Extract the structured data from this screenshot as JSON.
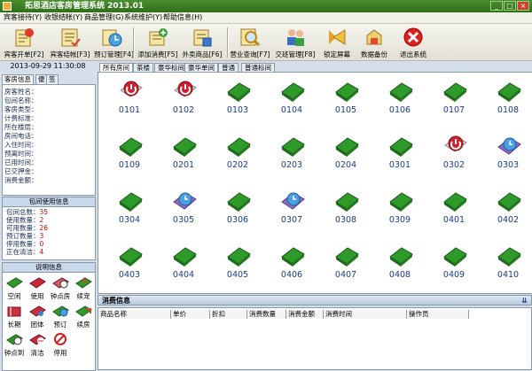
{
  "app": {
    "title": "拓思酒店客房管理系统   2013.01",
    "controls": [
      "_",
      "□",
      "×"
    ]
  },
  "menu": [
    "宾客接待(Y)",
    "收银结帐(Y)",
    "商品管理(G)",
    "系统维护(Y)",
    "帮助信息(H)"
  ],
  "toolbar": [
    {
      "label": "宾客开单[F2]",
      "icon": "open-bill-icon"
    },
    {
      "label": "宾客结帐[F3]",
      "icon": "checkout-icon"
    },
    {
      "label": "预订管理[F4]",
      "icon": "reservation-icon"
    },
    {
      "label": "添加消费[F5]",
      "icon": "add-consumption-icon"
    },
    {
      "label": "外卖商品[F6]",
      "icon": "takeout-icon"
    },
    {
      "label": "营业查询[F7]",
      "icon": "query-icon"
    },
    {
      "label": "交班管理[F8]",
      "icon": "shift-icon"
    },
    {
      "label": "锁定屏幕",
      "icon": "lock-screen-icon"
    },
    {
      "label": "数据备份",
      "icon": "backup-icon"
    },
    {
      "label": "退出系统",
      "icon": "exit-icon"
    }
  ],
  "datetime": "2013-09-29 11:30:08",
  "left_tabs": [
    "客房信息",
    "便",
    "签"
  ],
  "room_fields": [
    "房客姓名：",
    "包间名称：",
    "客房类型：",
    "计费标准：",
    "所在楼层：",
    "房间电话：",
    "入住时间：",
    "预离时间：",
    "已用时间：",
    "已交押金：",
    "消费金额："
  ],
  "usage": {
    "title": "包间使用信息",
    "rows": [
      {
        "label": "包间总数：",
        "value": "35"
      },
      {
        "label": "使用数量：",
        "value": "2"
      },
      {
        "label": "可用数量：",
        "value": "26"
      },
      {
        "label": "预订数量：",
        "value": "3"
      },
      {
        "label": "停用数量：",
        "value": "0"
      },
      {
        "label": "正在清洁：",
        "value": "4"
      }
    ]
  },
  "legend": {
    "title": "说明信息",
    "items": [
      {
        "label": "空闲",
        "icon": "idle-room-icon"
      },
      {
        "label": "使用",
        "icon": "in-use-icon"
      },
      {
        "label": "钟点房",
        "icon": "hourly-room-icon"
      },
      {
        "label": "续宠",
        "icon": "renew-icon"
      },
      {
        "label": "长期",
        "icon": "long-term-icon"
      },
      {
        "label": "团体",
        "icon": "group-icon"
      },
      {
        "label": "预订",
        "icon": "reserved-icon"
      },
      {
        "label": "续房",
        "icon": "extend-room-icon"
      },
      {
        "label": "钟点到",
        "icon": "hourly-due-icon"
      },
      {
        "label": "清洁",
        "icon": "cleaning-icon"
      },
      {
        "label": "停用",
        "icon": "disabled-icon"
      }
    ]
  },
  "room_tabs": [
    "所有房间",
    "茶楼",
    "豪华标间",
    "豪华单间",
    "普通",
    "普通标间"
  ],
  "rooms": [
    {
      "no": "0101",
      "status": "in-use"
    },
    {
      "no": "0102",
      "status": "in-use"
    },
    {
      "no": "0103",
      "status": "idle"
    },
    {
      "no": "0104",
      "status": "idle"
    },
    {
      "no": "0105",
      "status": "idle"
    },
    {
      "no": "0106",
      "status": "idle"
    },
    {
      "no": "0107",
      "status": "idle"
    },
    {
      "no": "0108",
      "status": "idle"
    },
    {
      "no": "0109",
      "status": "idle"
    },
    {
      "no": "0201",
      "status": "idle"
    },
    {
      "no": "0202",
      "status": "idle"
    },
    {
      "no": "0203",
      "status": "idle"
    },
    {
      "no": "0204",
      "status": "idle"
    },
    {
      "no": "0301",
      "status": "idle"
    },
    {
      "no": "0302",
      "status": "in-use"
    },
    {
      "no": "0303",
      "status": "reserved"
    },
    {
      "no": "0304",
      "status": "idle"
    },
    {
      "no": "0305",
      "status": "reserved"
    },
    {
      "no": "0306",
      "status": "idle"
    },
    {
      "no": "0307",
      "status": "reserved"
    },
    {
      "no": "0308",
      "status": "idle"
    },
    {
      "no": "0309",
      "status": "idle"
    },
    {
      "no": "0401",
      "status": "idle"
    },
    {
      "no": "0402",
      "status": "idle"
    },
    {
      "no": "0403",
      "status": "idle"
    },
    {
      "no": "0404",
      "status": "idle"
    },
    {
      "no": "0405",
      "status": "idle"
    },
    {
      "no": "0406",
      "status": "idle"
    },
    {
      "no": "0407",
      "status": "idle"
    },
    {
      "no": "0408",
      "status": "idle"
    },
    {
      "no": "0409",
      "status": "idle"
    },
    {
      "no": "0410",
      "status": "idle"
    },
    {
      "no": "",
      "status": "idle"
    },
    {
      "no": "",
      "status": "idle"
    },
    {
      "no": "",
      "status": "in-use"
    }
  ],
  "consumption": {
    "title": "消费信息",
    "columns": [
      "商品名称",
      "单价",
      "折扣",
      "消费数量",
      "消费金额",
      "消费时间",
      "操作员"
    ]
  },
  "colors": {
    "idle": "#2e9a2a",
    "in_use": "#d9d9d9",
    "reserved": "#8f6bc0",
    "accent": "#2f6e1a",
    "value_red": "#d40000"
  }
}
